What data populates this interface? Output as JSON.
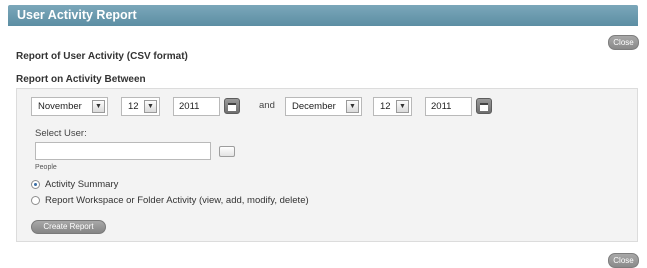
{
  "window": {
    "title": "User Activity Report"
  },
  "buttons": {
    "close_top": "Close",
    "close_bottom": "Close",
    "create_report": "Create Report"
  },
  "headings": {
    "report_format": "Report of User Activity (CSV format)",
    "activity_between": "Report on Activity Between"
  },
  "date_range": {
    "start": {
      "month": "November",
      "day": "12",
      "year": "2011"
    },
    "connector": "and",
    "end": {
      "month": "December",
      "day": "12",
      "year": "2011"
    }
  },
  "user": {
    "label": "Select User:",
    "value": "",
    "hint": "People"
  },
  "report_type": {
    "options": [
      {
        "label": "Activity Summary",
        "selected": true
      },
      {
        "label": "Report Workspace or Folder Activity (view, add, modify, delete)",
        "selected": false
      }
    ]
  },
  "icons": {
    "dropdown": "chevron-down-icon",
    "calendar": "calendar-icon",
    "browse": "browse-people-icon"
  }
}
